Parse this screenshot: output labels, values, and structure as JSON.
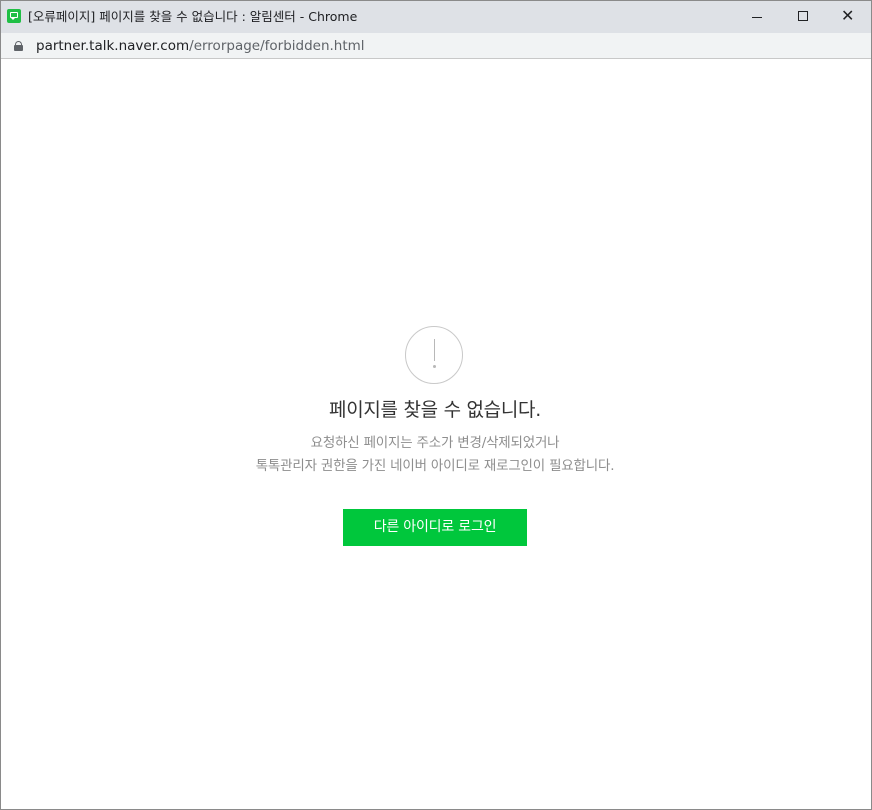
{
  "window": {
    "title": "[오류페이지] 페이지를 찾을 수 없습니다 : 알림센터 - Chrome",
    "favicon": "naver-talktalk-icon",
    "controls": {
      "minimize": "minimize-icon",
      "maximize": "maximize-icon",
      "close": "✕"
    }
  },
  "address_bar": {
    "lock_icon": "lock-icon",
    "url_host": "partner.talk.naver.com",
    "url_path": "/errorpage/forbidden.html"
  },
  "error_page": {
    "icon": "exclamation-circle-icon",
    "heading": "페이지를 찾을 수 없습니다.",
    "description_line1": "요청하신 페이지는 주소가 변경/삭제되었거나",
    "description_line2": "톡톡관리자 권한을 가진 네이버 아이디로 재로그인이 필요합니다.",
    "button_label": "다른 아이디로 로그인",
    "button_color": "#00c73c"
  }
}
